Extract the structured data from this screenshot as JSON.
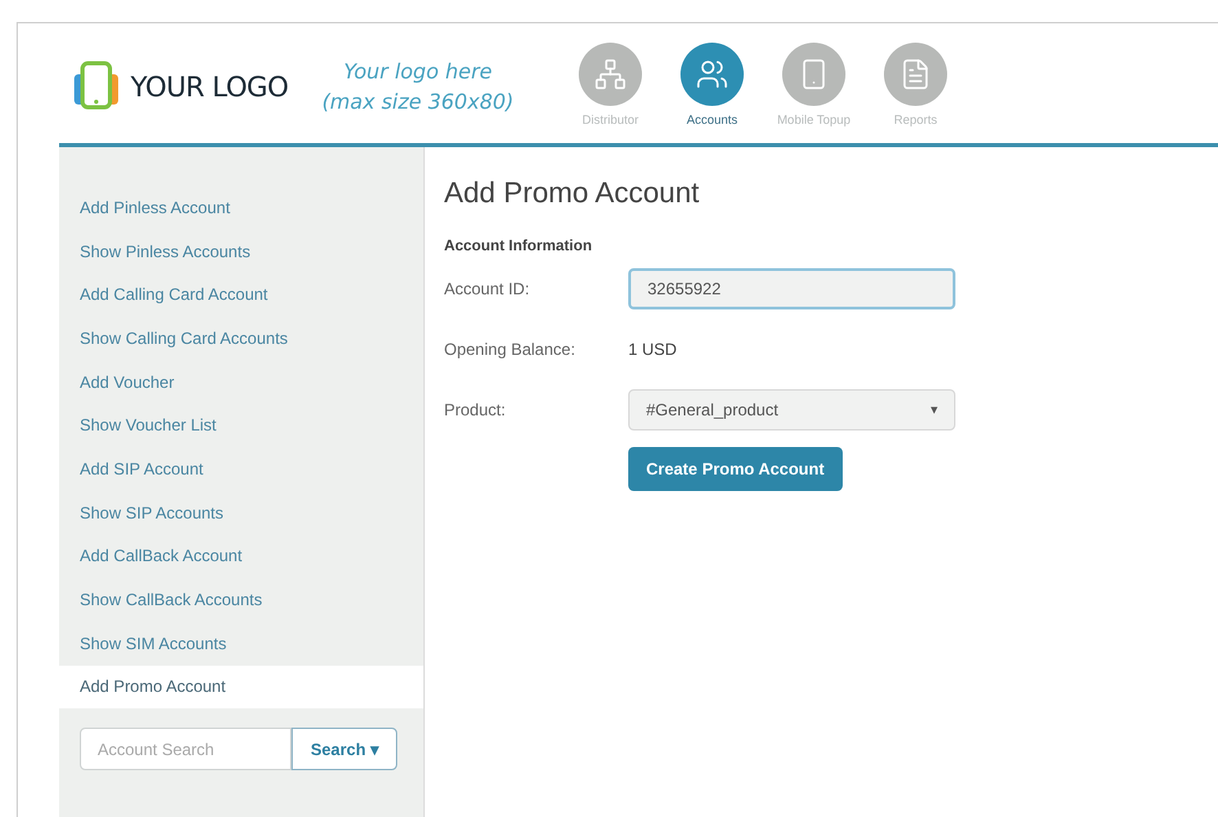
{
  "logo": {
    "text": "YOUR LOGO"
  },
  "logo_hint": [
    "Your logo here",
    "(max size 360x80)"
  ],
  "nav": [
    {
      "kind": "network",
      "label": "Distributor",
      "selected": false
    },
    {
      "kind": "accounts",
      "label": "Accounts",
      "selected": true
    },
    {
      "kind": "phone",
      "label": "Mobile Topup",
      "selected": false
    },
    {
      "kind": "document",
      "label": "Reports",
      "selected": false
    }
  ],
  "sidebar": {
    "items": [
      {
        "label": "Add Pinless Account",
        "selected": false
      },
      {
        "label": "Show Pinless Accounts",
        "selected": false
      },
      {
        "label": "Add Calling Card Account",
        "selected": false
      },
      {
        "label": "Show Calling Card Accounts",
        "selected": false
      },
      {
        "label": "Add Voucher",
        "selected": false
      },
      {
        "label": "Show Voucher List",
        "selected": false
      },
      {
        "label": "Add SIP Account",
        "selected": false
      },
      {
        "label": "Show SIP Accounts",
        "selected": false
      },
      {
        "label": "Add CallBack Account",
        "selected": false
      },
      {
        "label": "Show CallBack Accounts",
        "selected": false
      },
      {
        "label": "Show SIM Accounts",
        "selected": false
      },
      {
        "label": "Add Promo Account",
        "selected": true
      }
    ],
    "search": {
      "placeholder": "Account Search",
      "button": "Search ▾"
    }
  },
  "form": {
    "title": "Add Promo Account",
    "section": "Account Information",
    "fields": [
      {
        "kind": "input",
        "label": "Account ID:",
        "value": "32655922"
      },
      {
        "kind": "text",
        "label": "Opening Balance:",
        "value": "1 USD"
      },
      {
        "kind": "select",
        "label": "Product:",
        "value": "#General_product",
        "arrow": "▾"
      }
    ],
    "submit": "Create Promo Account"
  }
}
